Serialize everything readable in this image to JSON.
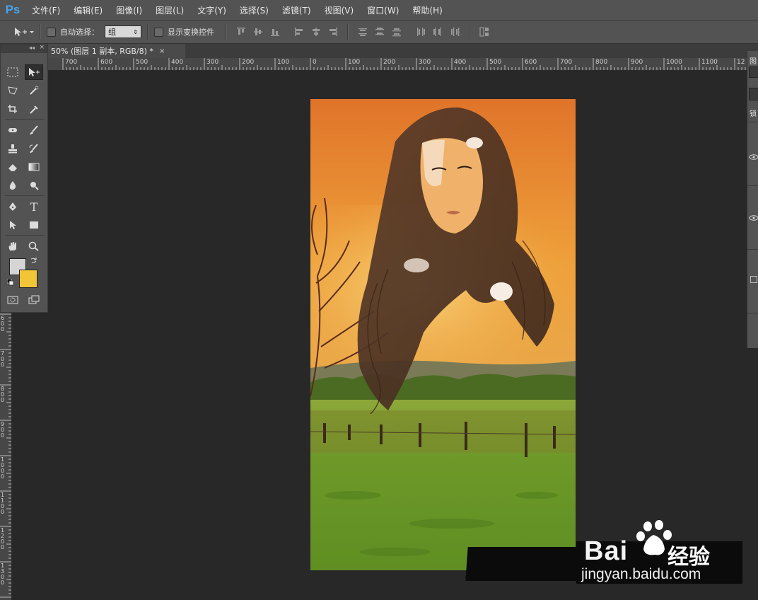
{
  "app": {
    "logo": "Ps",
    "menu": [
      "文件(F)",
      "编辑(E)",
      "图像(I)",
      "图层(L)",
      "文字(Y)",
      "选择(S)",
      "滤镜(T)",
      "视图(V)",
      "窗口(W)",
      "帮助(H)"
    ]
  },
  "options": {
    "auto_select_label": "自动选择：",
    "group_value": "组",
    "show_transform_label": "显示变换控件"
  },
  "document": {
    "tab_title": "50% (图层 1 副本, RGB/8) *",
    "tab_close": "×",
    "ruler_top": [
      "700",
      "600",
      "500",
      "400",
      "300",
      "200",
      "100",
      "0",
      "100",
      "200",
      "300",
      "400",
      "500",
      "600",
      "700",
      "800",
      "900",
      "1000",
      "1100",
      "12"
    ],
    "ruler_left": [
      "600",
      "700",
      "800",
      "900",
      "1000",
      "1100",
      "1200",
      "1300"
    ]
  },
  "toolbox": {
    "collapse": "◂◂",
    "close": "×",
    "tools": [
      "rectangular-marquee",
      "move",
      "polygonal-lasso",
      "quick-selection",
      "crop",
      "eyedropper",
      "spot-healing",
      "brush",
      "clone-stamp",
      "history-brush",
      "eraser",
      "gradient",
      "blur",
      "dodge",
      "pen",
      "type",
      "path-selection",
      "rectangle",
      "hand",
      "zoom"
    ],
    "type_glyph": "T",
    "colors": {
      "foreground": "#d5d5d5",
      "background": "#f2c539"
    }
  },
  "right_panel": {
    "label_1": "图",
    "label_2": "锁"
  },
  "watermark": {
    "brand": "Bai",
    "suffix": "经验",
    "url": "jingyan.baidu.com"
  }
}
